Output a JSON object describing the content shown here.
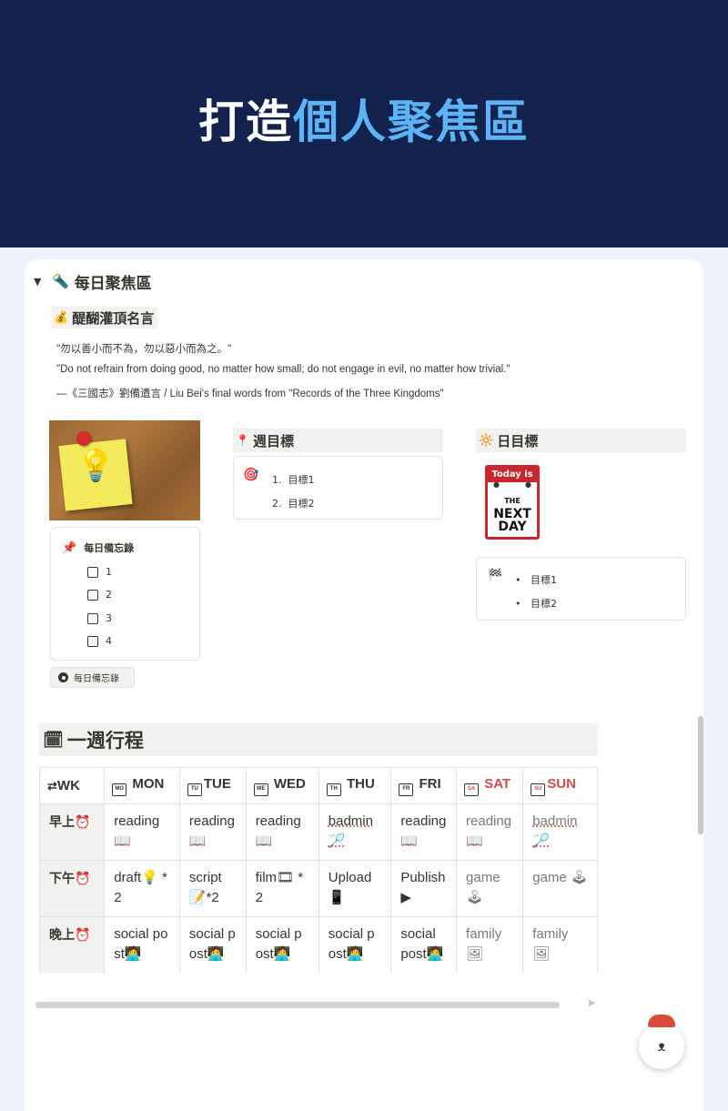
{
  "banner": {
    "title_white": "打造",
    "title_blue": "個人聚焦區"
  },
  "focus": {
    "toggle_label": "每日聚焦區",
    "toggle_icon": "flashlight-icon",
    "quote_heading": "醍醐灌頂名言",
    "quote_zh": "\"勿以善小而不為，勿以惡小而為之。\"",
    "quote_en": "\"Do not refrain from doing good, no matter how small; do not engage in evil, no matter how trivial.\"",
    "quote_src": "—《三國志》劉備遺言 / Liu Bei's final words from \"Records of the Three Kingdoms\""
  },
  "memo": {
    "title": "每日備忘錄",
    "items": [
      "1",
      "2",
      "3",
      "4"
    ],
    "button_label": "每日備忘錄"
  },
  "weekly_goals": {
    "heading": "週目標",
    "items": [
      "目標1",
      "目標2"
    ]
  },
  "daily_goals": {
    "heading": "日目標",
    "calendar_band": "Today is",
    "calendar_text_1": "THE",
    "calendar_text_2": "NEXT",
    "calendar_text_3": "DAY",
    "items": [
      "目標1",
      "目標2"
    ]
  },
  "schedule": {
    "heading": "一週行程",
    "columns": [
      {
        "label": "WK",
        "icon": ""
      },
      {
        "label": "MON",
        "icon": "MO"
      },
      {
        "label": "TUE",
        "icon": "TU"
      },
      {
        "label": "WED",
        "icon": "WE"
      },
      {
        "label": "THU",
        "icon": "TH"
      },
      {
        "label": "FRI",
        "icon": "FR"
      },
      {
        "label": "SAT",
        "icon": "SA"
      },
      {
        "label": "SUN",
        "icon": "SU"
      }
    ],
    "rows": [
      {
        "label": "早上",
        "cells": [
          "reading 📖",
          "reading 📖",
          "reading 📖",
          "badmin 🏸",
          "reading 📖",
          "reading 📖",
          "badmin 🏸"
        ]
      },
      {
        "label": "下午",
        "cells": [
          "draft💡 *2",
          "script 📝*2",
          "film🎞 *2",
          "Upload 📱",
          "Publish ▶",
          "game 🕹",
          "game 🕹"
        ]
      },
      {
        "label": "晚上",
        "cells": [
          "social post🧑‍💻",
          "social post🧑‍💻",
          "social post🧑‍💻",
          "social post🧑‍💻",
          "social post🧑‍💻",
          "family 🖼",
          "family 🖼"
        ]
      }
    ]
  },
  "colors": {
    "banner_bg": "#13234d",
    "banner_accent": "#5cb3f5",
    "weekend_red": "#d44c47"
  }
}
